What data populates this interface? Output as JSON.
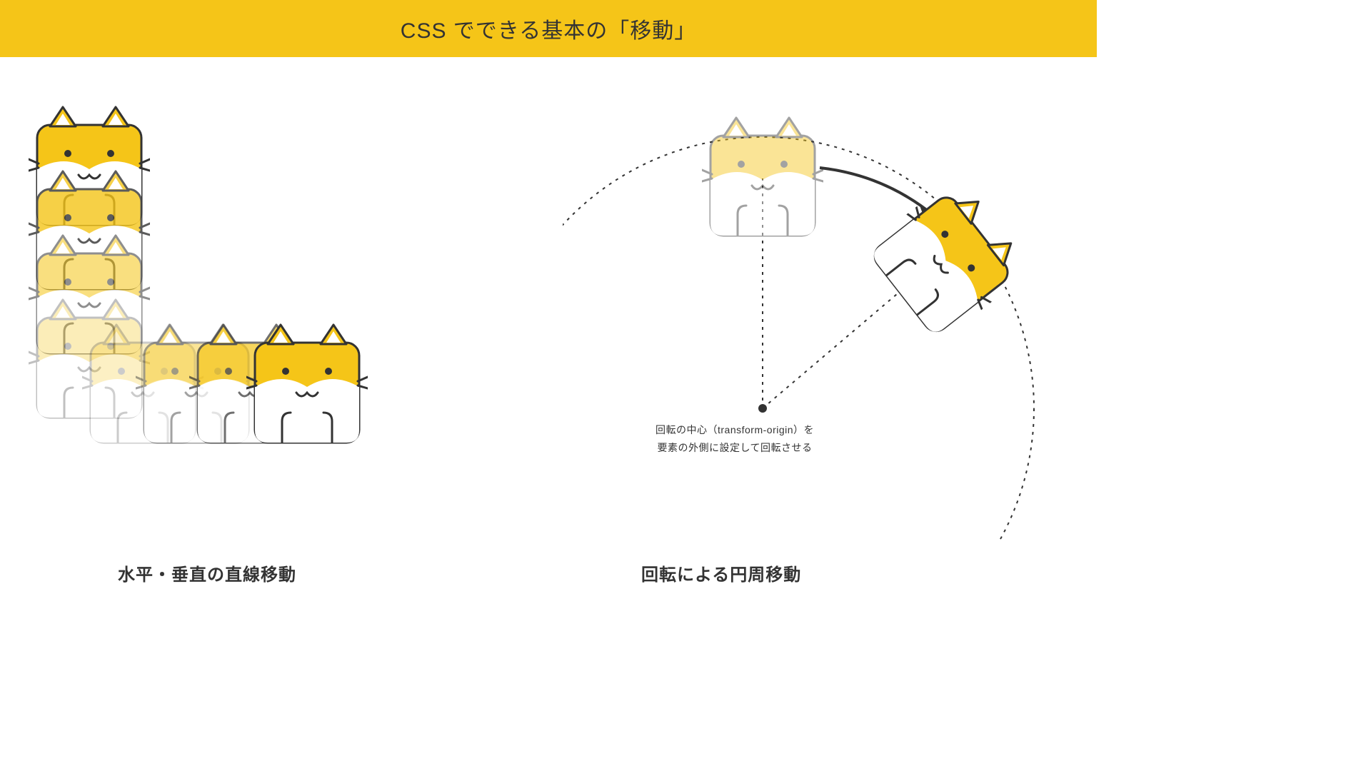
{
  "header": {
    "title": "CSS でできる基本の「移動」"
  },
  "left": {
    "caption": "水平・垂直の直線移動"
  },
  "right": {
    "caption": "回転による円周移動",
    "note_line1": "回転の中心（transform-origin）を",
    "note_line2": "要素の外側に設定して回転させる"
  },
  "icons": {
    "cat": "cat-icon"
  }
}
